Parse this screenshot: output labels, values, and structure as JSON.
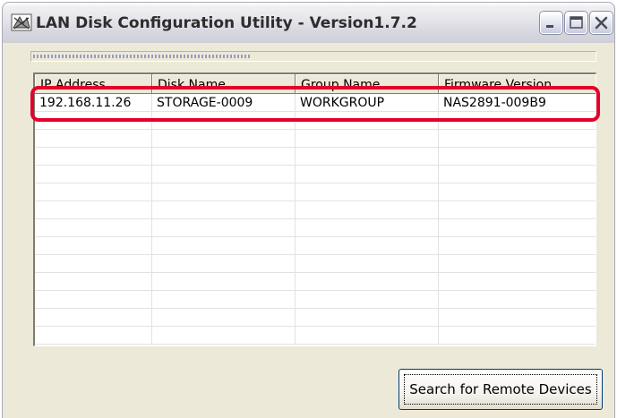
{
  "window": {
    "title": "LAN Disk Configuration Utility - Version1.7.2",
    "app_icon": "network-tool-icon",
    "buttons": {
      "minimize": "minimize-icon",
      "maximize": "maximize-icon",
      "close": "close-icon"
    }
  },
  "progress": {
    "fraction": 0.39
  },
  "device_list": {
    "columns": [
      "IP Address",
      "Disk Name",
      "Group Name",
      "Firmware Version"
    ],
    "rows": [
      [
        "192.168.11.26",
        "STORAGE-0009",
        "WORKGROUP",
        "NAS2891-009B9"
      ]
    ],
    "empty_row_count": 13
  },
  "annotation": {
    "highlight_color": "#e4002b"
  },
  "actions": {
    "search_label": "Search for Remote Devices"
  }
}
